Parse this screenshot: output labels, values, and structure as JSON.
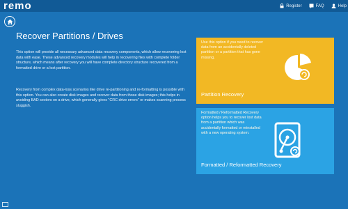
{
  "app": {
    "logo": "remo"
  },
  "topnav": {
    "items": [
      {
        "label": "Register",
        "icon": "lock-icon"
      },
      {
        "label": "FAQ",
        "icon": "faq-icon"
      },
      {
        "label": "Help",
        "icon": "user-icon"
      }
    ]
  },
  "main": {
    "title": "Recover Partitions / Drives",
    "paragraph1": "This option will provide all necessary advanced data recovery components, which allow recovering lost data with ease. These advanced recovery modules will help in recovering files with complete folder structure, which means after recovery you will have complete directory structure recovered from a formatted drive or a lost partition.",
    "paragraph2": "Recovery from complex data-loss scenarios like drive re-partitioning and re-formatting is possible with this option. You can also create disk images and recover data from those disk images; this helps in avoiding BAD sectors on a drive, which generally gives \"CRC drive errors\" or makes scanning process sluggish."
  },
  "tiles": [
    {
      "label": "Partition Recovery",
      "description": "Use this option if you need to recover data from an accidentally deleted partition or a partition that has gone missing.",
      "icon": "partition-pie-icon",
      "color": "#f2b824"
    },
    {
      "label": "Formatted / Reformatted Recovery",
      "description": "Formatted / Reformatted Recovery option helps you to recover lost data from a partition which was accidentally formatted or reinstalled with a new operating system.",
      "icon": "hard-drive-icon",
      "color": "#2ba3e4"
    }
  ],
  "colors": {
    "background": "#1b73b8",
    "topbar": "#115a96"
  }
}
